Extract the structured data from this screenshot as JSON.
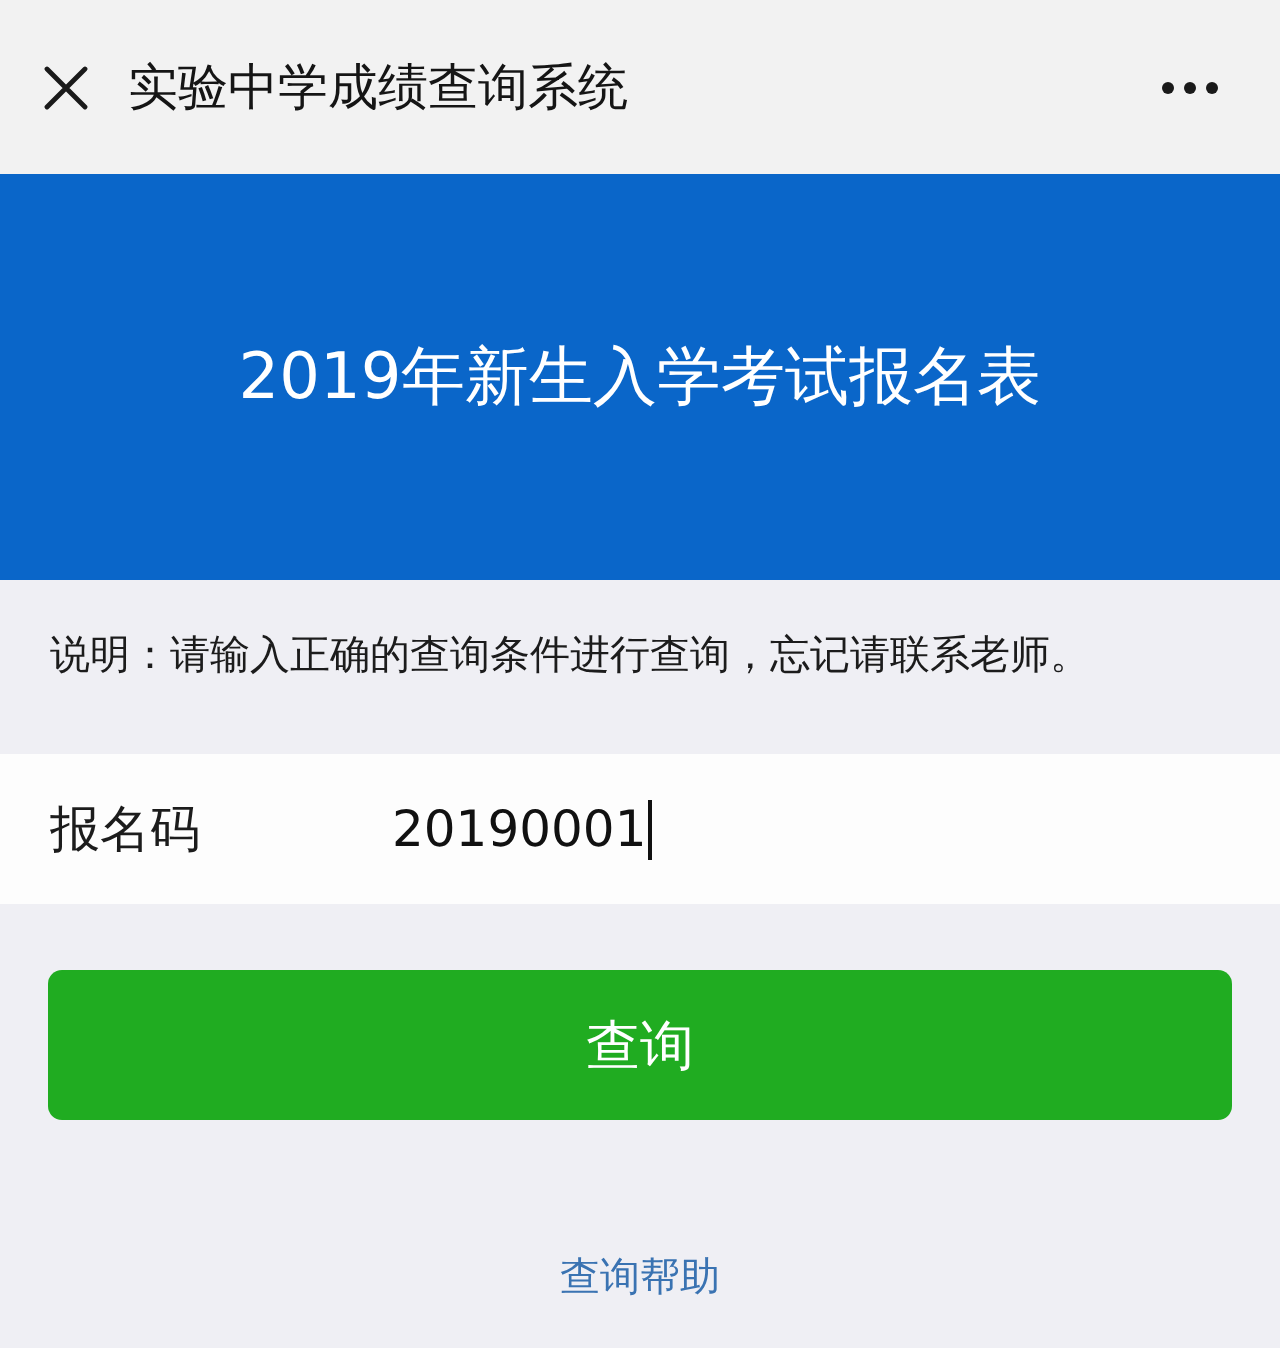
{
  "window": {
    "title": "实验中学成绩查询系统"
  },
  "banner": {
    "title": "2019年新生入学考试报名表"
  },
  "notice": "说明：请输入正确的查询条件进行查询，忘记请联系老师。",
  "form": {
    "fields": [
      {
        "label": "报名码",
        "value": "20190001",
        "focused": true
      }
    ]
  },
  "buttons": [
    {
      "label": "查询",
      "kind": "primary"
    }
  ],
  "links": [
    {
      "label": "查询帮助"
    }
  ]
}
